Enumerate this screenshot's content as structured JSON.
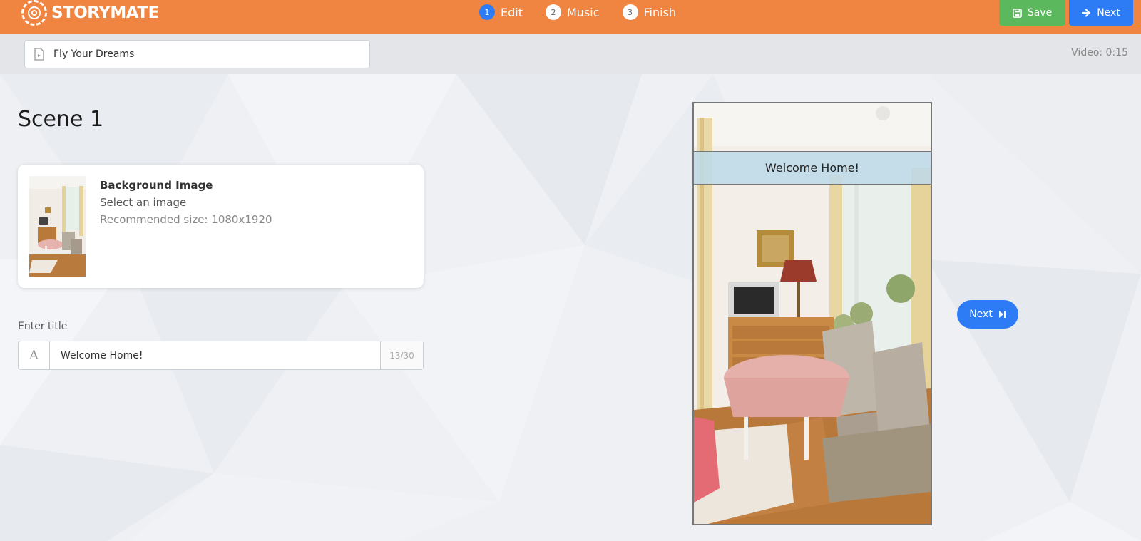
{
  "app": {
    "logo_text": "STORYMATE"
  },
  "steps": [
    {
      "number": "1",
      "label": "Edit",
      "active": true
    },
    {
      "number": "2",
      "label": "Music",
      "active": false
    },
    {
      "number": "3",
      "label": "Finish",
      "active": false
    }
  ],
  "toolbar": {
    "save_label": "Save",
    "next_label": "Next"
  },
  "project": {
    "name": "Fly Your Dreams",
    "video_length": "Video: 0:15"
  },
  "scene": {
    "title": "Scene 1",
    "background": {
      "heading": "Background Image",
      "action": "Select an image",
      "hint": "Recommended size: 1080x1920"
    },
    "title_field": {
      "label": "Enter title",
      "value": "Welcome Home!",
      "counter": "13/30"
    }
  },
  "preview": {
    "banner_text": "Welcome Home!",
    "next_label": "Next"
  },
  "colors": {
    "brand": "#f08541",
    "primary": "#2d7cf6",
    "save": "#5cb85c"
  },
  "icons": {
    "logo": "camera-shutter-icon",
    "save": "floppy-disk-icon",
    "next": "arrow-right-icon",
    "doc": "video-file-icon",
    "title_addon": "font-a-icon",
    "side_next": "skip-forward-icon"
  }
}
